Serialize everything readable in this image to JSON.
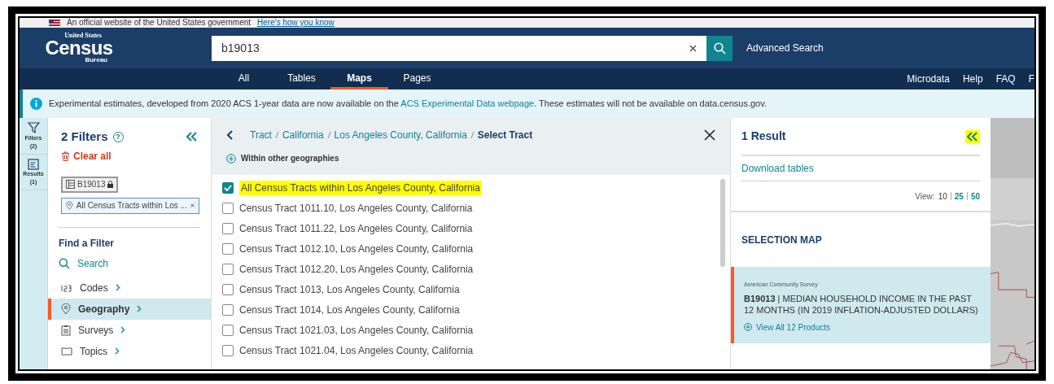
{
  "gov_banner": {
    "text": "An official website of the United States government",
    "link": "Here's how you know"
  },
  "header": {
    "logo": {
      "top": "United States",
      "main": "Census",
      "bottom": "Bureau"
    },
    "search": {
      "value": "b19013"
    },
    "advanced_search": "Advanced Search"
  },
  "nav": {
    "tabs": [
      {
        "label": "All",
        "selected": false
      },
      {
        "label": "Tables",
        "selected": false
      },
      {
        "label": "Maps",
        "selected": true
      },
      {
        "label": "Pages",
        "selected": false
      }
    ],
    "links": [
      "Microdata",
      "Help",
      "FAQ",
      "F"
    ]
  },
  "notice": {
    "before": "Experimental estimates, developed from 2020 ACS 1-year data are now available on the ",
    "link": "ACS Experimental Data webpage",
    "after": ". These estimates will not be available on data.census.gov."
  },
  "rail": [
    {
      "kind": "filters",
      "label": "Filters",
      "count": "(2)"
    },
    {
      "kind": "results",
      "label": "Results",
      "count": "(1)"
    }
  ],
  "filters": {
    "title": "2 Filters",
    "help": "?",
    "clear_all": "Clear all",
    "chips": [
      {
        "kind": "table",
        "label": "B19013"
      },
      {
        "kind": "geo",
        "label": "All Census Tracts within Los ..."
      }
    ],
    "find_title": "Find a Filter",
    "search": "Search",
    "categories": [
      {
        "kind": "codes",
        "label": "Codes",
        "selected": false
      },
      {
        "kind": "geo",
        "label": "Geography",
        "selected": true
      },
      {
        "kind": "surveys",
        "label": "Surveys",
        "selected": false
      },
      {
        "kind": "topics",
        "label": "Topics",
        "selected": false
      }
    ]
  },
  "geography": {
    "breadcrumb": [
      "Tract",
      "California",
      "Los Angeles County, California"
    ],
    "current": "Select Tract",
    "within": "Within other geographies",
    "items": [
      {
        "label": "All Census Tracts within Los Angeles County, California",
        "checked": true,
        "highlighted": true
      },
      {
        "label": "Census Tract 1011.10, Los Angeles County, California",
        "checked": false,
        "highlighted": false
      },
      {
        "label": "Census Tract 1011.22, Los Angeles County, California",
        "checked": false,
        "highlighted": false
      },
      {
        "label": "Census Tract 1012.10, Los Angeles County, California",
        "checked": false,
        "highlighted": false
      },
      {
        "label": "Census Tract 1012.20, Los Angeles County, California",
        "checked": false,
        "highlighted": false
      },
      {
        "label": "Census Tract 1013, Los Angeles County, California",
        "checked": false,
        "highlighted": false
      },
      {
        "label": "Census Tract 1014, Los Angeles County, California",
        "checked": false,
        "highlighted": false
      },
      {
        "label": "Census Tract 1021.03, Los Angeles County, California",
        "checked": false,
        "highlighted": false
      },
      {
        "label": "Census Tract 1021.04, Los Angeles County, California",
        "checked": false,
        "highlighted": false
      }
    ]
  },
  "results": {
    "title": "1 Result",
    "collapse_highlighted": true,
    "download": "Download tables",
    "view_label": "View:",
    "view_options": [
      {
        "label": "10",
        "selected": true
      },
      {
        "label": "25",
        "selected": false
      },
      {
        "label": "50",
        "selected": false
      }
    ],
    "selection_map": "SELECTION MAP",
    "card": {
      "survey": "American Community Survey",
      "code": "B19013",
      "separator": "|",
      "title": "MEDIAN HOUSEHOLD INCOME IN THE PAST 12 MONTHS (IN 2019 INFLATION-ADJUSTED DOLLARS)",
      "products": "View All 12 Products"
    }
  }
}
